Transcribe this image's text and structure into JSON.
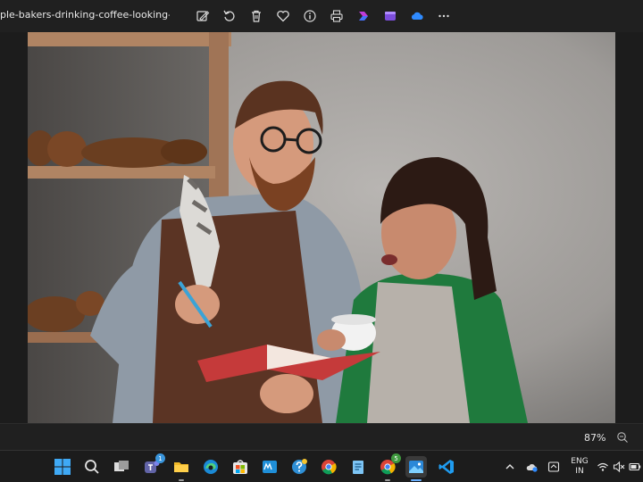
{
  "window": {
    "filename": "ple-bakers-drinking-coffee-looking-notebook"
  },
  "toolbar": {
    "icons": [
      "edit-image-icon",
      "rotate-icon",
      "delete-icon",
      "favorite-icon",
      "info-icon",
      "print-icon",
      "copilot-icon",
      "clipchamp-icon",
      "onedrive-icon",
      "more-icon"
    ]
  },
  "status": {
    "zoom": "87%"
  },
  "taskbar": {
    "apps": [
      "start",
      "search",
      "task-view",
      "teams",
      "file-explorer",
      "edge",
      "microsoft-store",
      "mail",
      "get-help",
      "chrome",
      "notepad",
      "chrome-profile",
      "photos",
      "vscode"
    ],
    "teams_badge": "1",
    "chrome_badge": "5"
  },
  "tray": {
    "language_line1": "ENG",
    "language_line2": "IN"
  },
  "colors": {
    "background": "#202020",
    "accent": "#6ab0ff"
  }
}
